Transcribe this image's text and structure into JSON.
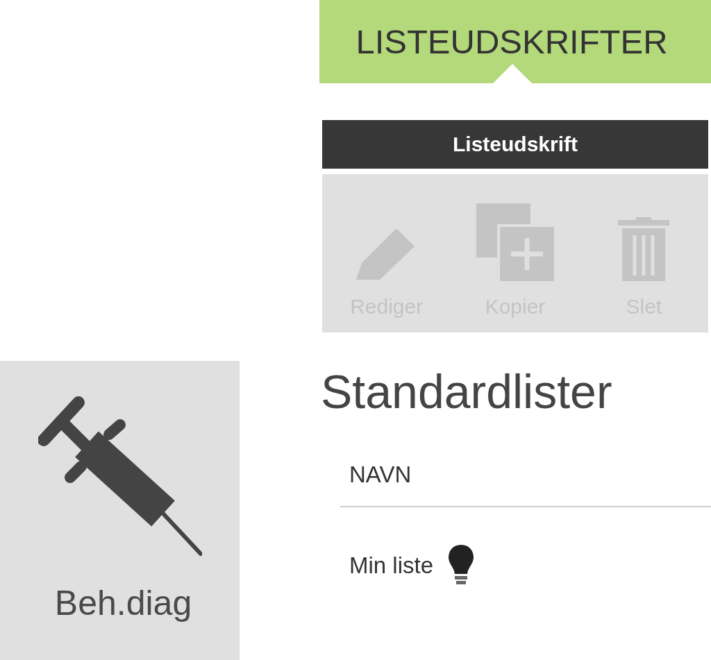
{
  "tile": {
    "label": "Beh.diag"
  },
  "panel": {
    "title": "LISTEUDSKRIFTER",
    "toolbar": {
      "title": "Listeudskrift",
      "buttons": [
        {
          "kind": "edit",
          "label": "Rediger",
          "disabled": true
        },
        {
          "kind": "copy",
          "label": "Kopier",
          "disabled": true
        },
        {
          "kind": "delete",
          "label": "Slet",
          "disabled": true
        }
      ]
    },
    "section_title": "Standardlister",
    "table": {
      "columns": [
        "NAVN"
      ],
      "rows": [
        {
          "name": "Min liste"
        }
      ]
    }
  }
}
